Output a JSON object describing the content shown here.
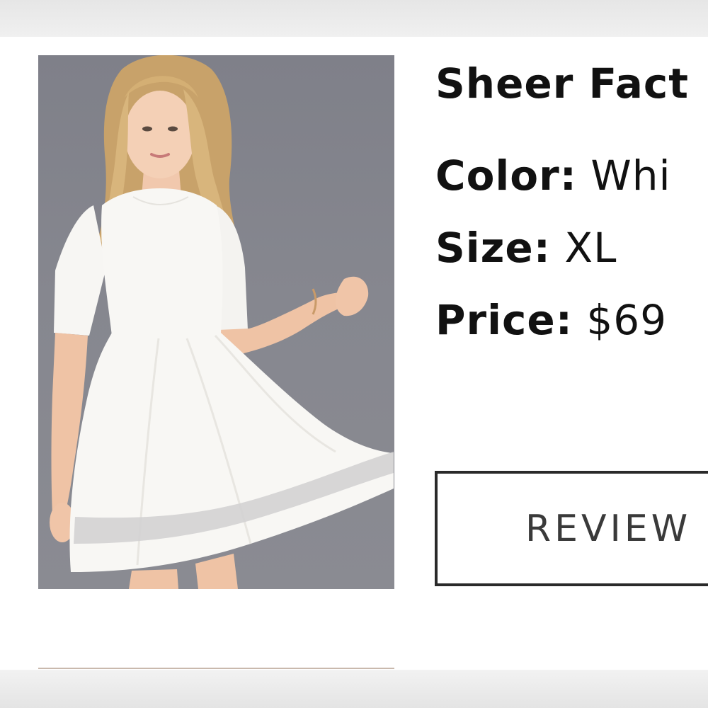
{
  "product": {
    "title": "Sheer Fact",
    "image_alt": "White skater dress with sheer mesh hem",
    "details": [
      {
        "key": "Color:",
        "value": "Whi"
      },
      {
        "key": "Size:",
        "value": "XL"
      },
      {
        "key": "Price:",
        "value": "$69"
      }
    ]
  },
  "actions": {
    "review_label": "REVIEW"
  },
  "colors": {
    "photo_background": "#84858d",
    "dress": "#f7f6f3",
    "text": "#111111",
    "button_border": "#2a2a2a"
  }
}
